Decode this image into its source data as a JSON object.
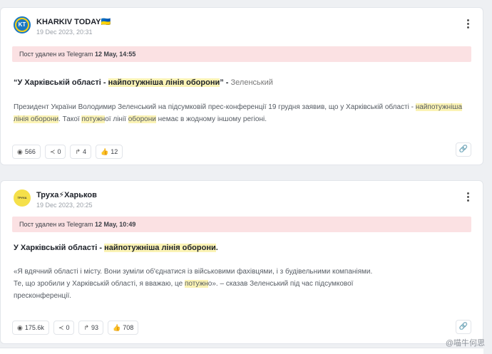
{
  "posts": [
    {
      "channel": "KHARKIV TODAY🇺🇦",
      "avatar_text": "KT",
      "date": "19 Dec 2023, 20:31",
      "deleted_prefix": "Пост удален из Telegram ",
      "deleted_when": "12 May, 14:55",
      "headline_parts": [
        "“У Харківській області - ",
        "найпотужніша лінія оборони",
        "” - ",
        "Зеленський"
      ],
      "body_parts": [
        "Президент України Володимир Зеленський на підсумковій прес-конференції 19 грудня заявив, що у Харківській області - ",
        "найпотужніша лінія оборони",
        ". Такої ",
        "потужн",
        "ої лінії ",
        "оборони",
        " немає в жодному іншому регіоні."
      ],
      "stats": {
        "views": "566",
        "shares": "0",
        "forwards": "4",
        "likes": "12"
      }
    },
    {
      "channel": "Труха⚡Харьков",
      "avatar_text": "ТРУХА",
      "date": "19 Dec 2023, 20:25",
      "deleted_prefix": "Пост удален из Telegram ",
      "deleted_when": "12 May, 10:49",
      "headline_parts": [
        "У Харківській області - ",
        "найпотужніша лінія оборони",
        "."
      ],
      "body_parts": [
        "«Я вдячний області і місту. Вони зуміли об'єднатися із військовими фахівцями, і з будівельними компаніями.",
        "Те, що зробили у Харківській області, я вважаю, це ",
        "потужн",
        "о». – сказав Зеленський під час підсумкової",
        "пресконференції."
      ],
      "stats": {
        "views": "175.6k",
        "shares": "0",
        "forwards": "93",
        "likes": "708"
      }
    }
  ],
  "watermark": "@喵牛何思",
  "icons": [
    "more-vertical-icon",
    "eye-icon",
    "share-icon",
    "forward-icon",
    "thumbs-up-icon",
    "link-icon"
  ],
  "colors": {
    "banner_bg": "#fbe1e3",
    "highlight": "#fbf3b5",
    "kt_blue": "#1a78c2",
    "kt_yellow": "#f7d117"
  }
}
